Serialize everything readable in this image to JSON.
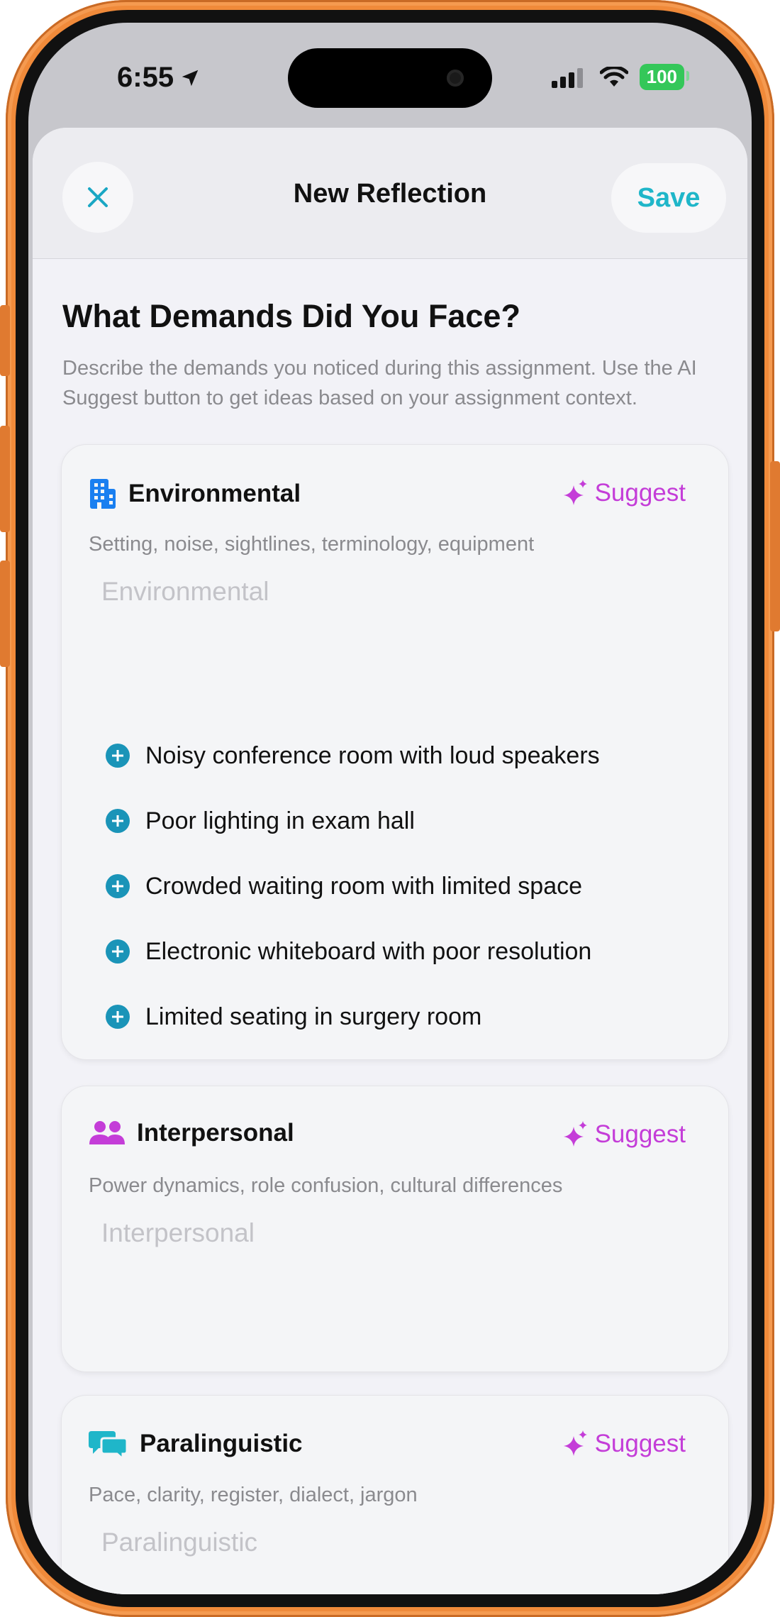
{
  "status_bar": {
    "time": "6:55",
    "battery": "100"
  },
  "nav": {
    "title": "New Reflection",
    "save_label": "Save"
  },
  "page": {
    "title": "What Demands Did You Face?",
    "description": "Describe the demands you noticed during this assignment. Use the AI Suggest button to get ideas based on your assignment context."
  },
  "categories": [
    {
      "title": "Environmental",
      "subtitle": "Setting, noise, sightlines, terminology, equipment",
      "placeholder": "Environmental",
      "suggest_label": "Suggest",
      "icon": "building-icon",
      "suggestions": [
        "Noisy conference room with loud speakers",
        "Poor lighting in exam hall",
        "Crowded waiting room with limited space",
        "Electronic whiteboard with poor resolution",
        "Limited seating in surgery room"
      ]
    },
    {
      "title": "Interpersonal",
      "subtitle": "Power dynamics, role confusion, cultural differences",
      "placeholder": "Interpersonal",
      "suggest_label": "Suggest",
      "icon": "people-icon"
    },
    {
      "title": "Paralinguistic",
      "subtitle": "Pace, clarity, register, dialect, jargon",
      "placeholder": "Paralinguistic",
      "suggest_label": "Suggest",
      "icon": "chat-bubbles-icon"
    }
  ],
  "colors": {
    "accent_teal": "#1fb6c9",
    "suggest_magenta": "#c43dd8",
    "environmental_icon": "#1a7ff0",
    "interpersonal_icon": "#c43dd8",
    "paralinguistic_icon": "#1fb6c9",
    "add_icon": "#1a94b8",
    "battery_green": "#34c759",
    "frame_orange": "#f08a3a"
  }
}
